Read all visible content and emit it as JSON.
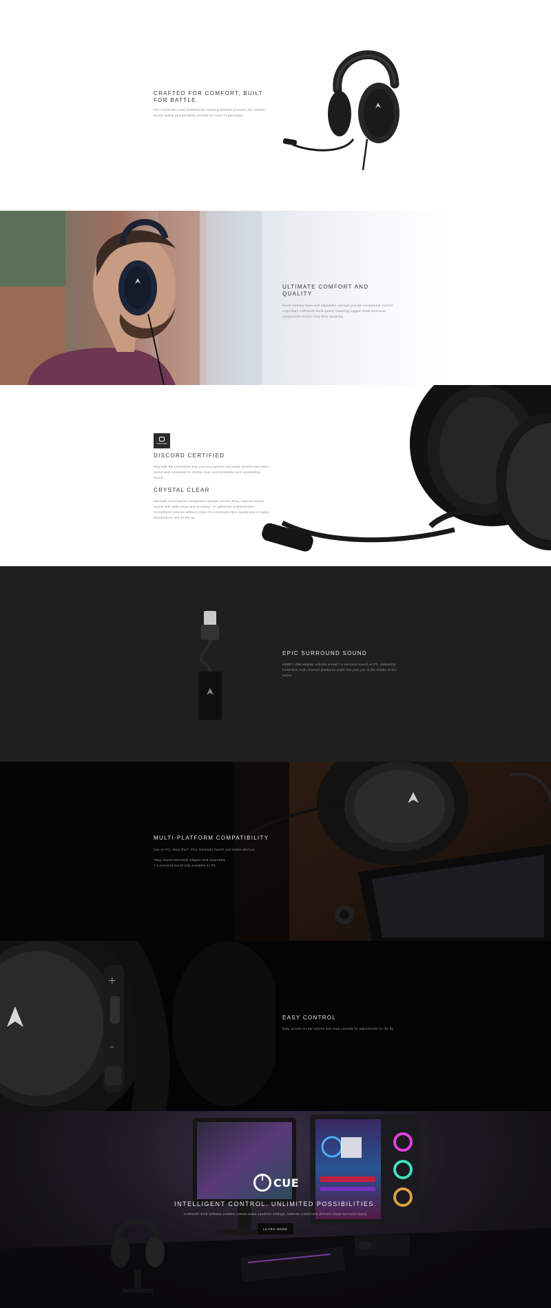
{
  "sections": {
    "crafted": {
      "title": "CRAFTED FOR COMFORT, BUILT FOR BATTLE.",
      "body": "The CORSAIR HS60 SURROUND Gaming Headset provides the comfort, sound quality and durability needed for hours of gameplay."
    },
    "comfort": {
      "title": "ULTIMATE COMFORT AND QUALITY",
      "body": "Plush memory foam and adjustable earcups provide exceptional comfort. Legendary CORSAIR build quality featuring rugged metal structural components ensure long-term durability."
    },
    "discord": {
      "badge": "DISCORD",
      "title": "DISCORD CERTIFIED",
      "body": "Play with the confidence that your microphone and audio drivers have been tested and evaluated for crystal clear communication and outstanding sound."
    },
    "crystal": {
      "title": "CRYSTAL CLEAR",
      "body": "Specially tuned 50mm neodymium speaker drivers bring superior sound quality with wide range and accuracy. An optimized unidirectional microphone reduces ambient noise for enhanced voice quality and is easily detached for use on the go."
    },
    "surround": {
      "title": "EPIC SURROUND SOUND",
      "body": "HS60's USB adapter unlocks virtual 7.1 surround sound on PC, delivering immersive multi-channel positional audio that puts you in the middle of the action."
    },
    "platform": {
      "title": "MULTI-PLATFORM COMPATIBILITY",
      "body": "Use on PC, Xbox One*, PS4, Nintendo Switch and mobile devices.",
      "note_1": "*May require Microsoft adapter sold separately",
      "note_2": "7.1 surround sound only available on PC"
    },
    "control": {
      "title": "EASY CONTROL",
      "body": "Easy access on-ear volume and mute controls for adjustments on the fly."
    },
    "cue": {
      "logo_text": "CUE",
      "title": "INTELLIGENT CONTROL. UNLIMITED POSSIBILITIES.",
      "body": "CORSAIR iCUE software enables custom audio equalizer settings, sidetone control and delivers virtual surround sound.",
      "button_label": "LEARN MORE"
    }
  },
  "colors": {
    "dark_bg": "#1f1f1f",
    "black_bg": "#050505",
    "accent_light": "#ffffff"
  }
}
